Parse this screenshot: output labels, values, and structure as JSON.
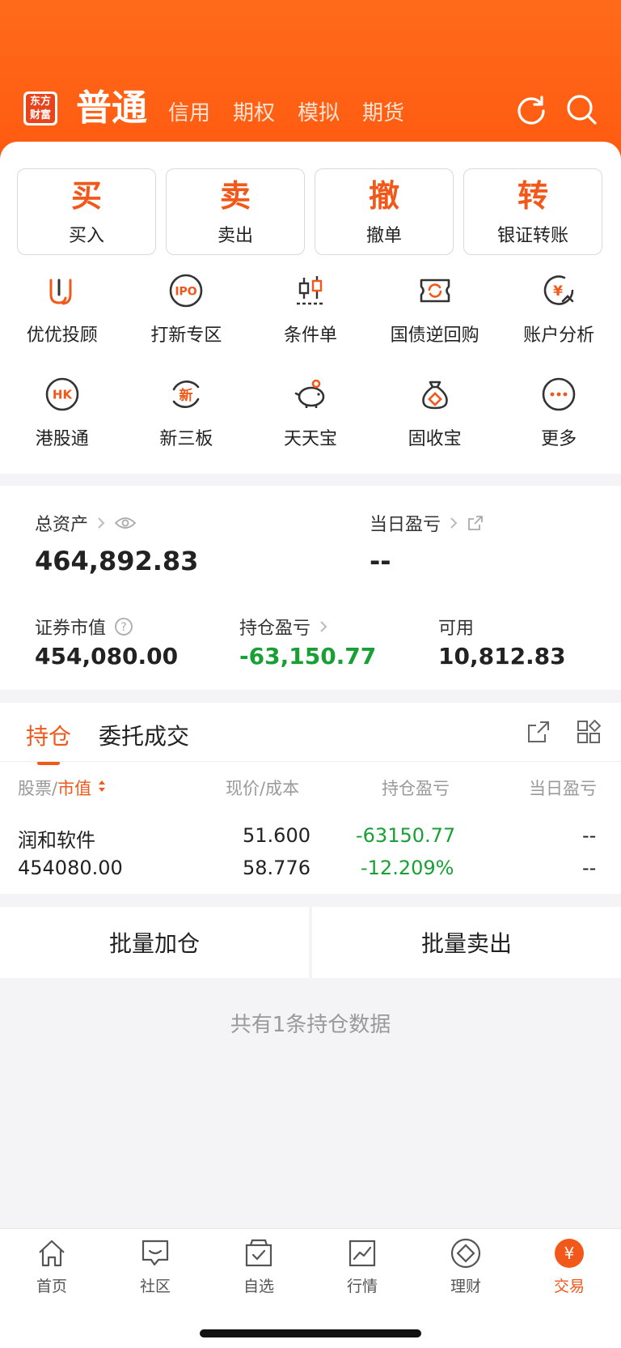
{
  "header": {
    "brand_line1": "东方",
    "brand_line2": "财富",
    "tab_active": "普通",
    "tabs": [
      "信用",
      "期权",
      "模拟",
      "期货"
    ],
    "icons": [
      "refresh-icon",
      "search-icon"
    ]
  },
  "actions": [
    {
      "big": "买",
      "small": "买入"
    },
    {
      "big": "卖",
      "small": "卖出"
    },
    {
      "big": "撤",
      "small": "撤单"
    },
    {
      "big": "转",
      "small": "银证转账"
    }
  ],
  "grid": [
    {
      "label": "优优投顾",
      "icon": "youyou-icon"
    },
    {
      "label": "打新专区",
      "icon": "ipo-icon",
      "icon_text": "IPO"
    },
    {
      "label": "条件单",
      "icon": "candlestick-icon"
    },
    {
      "label": "国债逆回购",
      "icon": "repo-icon"
    },
    {
      "label": "账户分析",
      "icon": "account-analysis-icon",
      "icon_text": "¥"
    },
    {
      "label": "港股通",
      "icon": "hk-icon",
      "icon_text": "HK"
    },
    {
      "label": "新三板",
      "icon": "new-board-icon",
      "icon_text": "新"
    },
    {
      "label": "天天宝",
      "icon": "piggy-bank-icon"
    },
    {
      "label": "固收宝",
      "icon": "money-bag-icon"
    },
    {
      "label": "更多",
      "icon": "more-icon"
    }
  ],
  "assets": {
    "total_label": "总资产",
    "total_value": "464,892.83",
    "daily_pl_label": "当日盈亏",
    "daily_pl_value": "--",
    "market_value_label": "证券市值",
    "market_value": "454,080.00",
    "position_pl_label": "持仓盈亏",
    "position_pl_value": "-63,150.77",
    "available_label": "可用",
    "available_value": "10,812.83"
  },
  "holdings": {
    "tab_positions": "持仓",
    "tab_orders": "委托成交",
    "col_stock": "股票",
    "col_sep": "/",
    "col_market_value": "市值",
    "col_price": "现价",
    "col_price_sep": "/",
    "col_cost": "成本",
    "col_position_pl": "持仓盈亏",
    "col_daily_pl": "当日盈亏",
    "rows": [
      {
        "name": "润和软件",
        "market_value": "454080.00",
        "price": "51.600",
        "cost": "58.776",
        "pl": "-63150.77",
        "pl_pct": "-12.209%",
        "daily_pl": "--",
        "daily_pl_pct": "--"
      }
    ]
  },
  "batch": {
    "add": "批量加仓",
    "sell": "批量卖出"
  },
  "summary": "共有1条持仓数据",
  "tabbar": [
    {
      "label": "首页",
      "icon": "home-icon"
    },
    {
      "label": "社区",
      "icon": "community-icon"
    },
    {
      "label": "自选",
      "icon": "watchlist-icon"
    },
    {
      "label": "行情",
      "icon": "market-icon"
    },
    {
      "label": "理财",
      "icon": "wealth-icon"
    },
    {
      "label": "交易",
      "icon": "trade-icon",
      "icon_text": "¥",
      "active": true
    }
  ],
  "colors": {
    "accent": "#f2581a",
    "header": "#ff5a10",
    "loss": "#19a035"
  }
}
